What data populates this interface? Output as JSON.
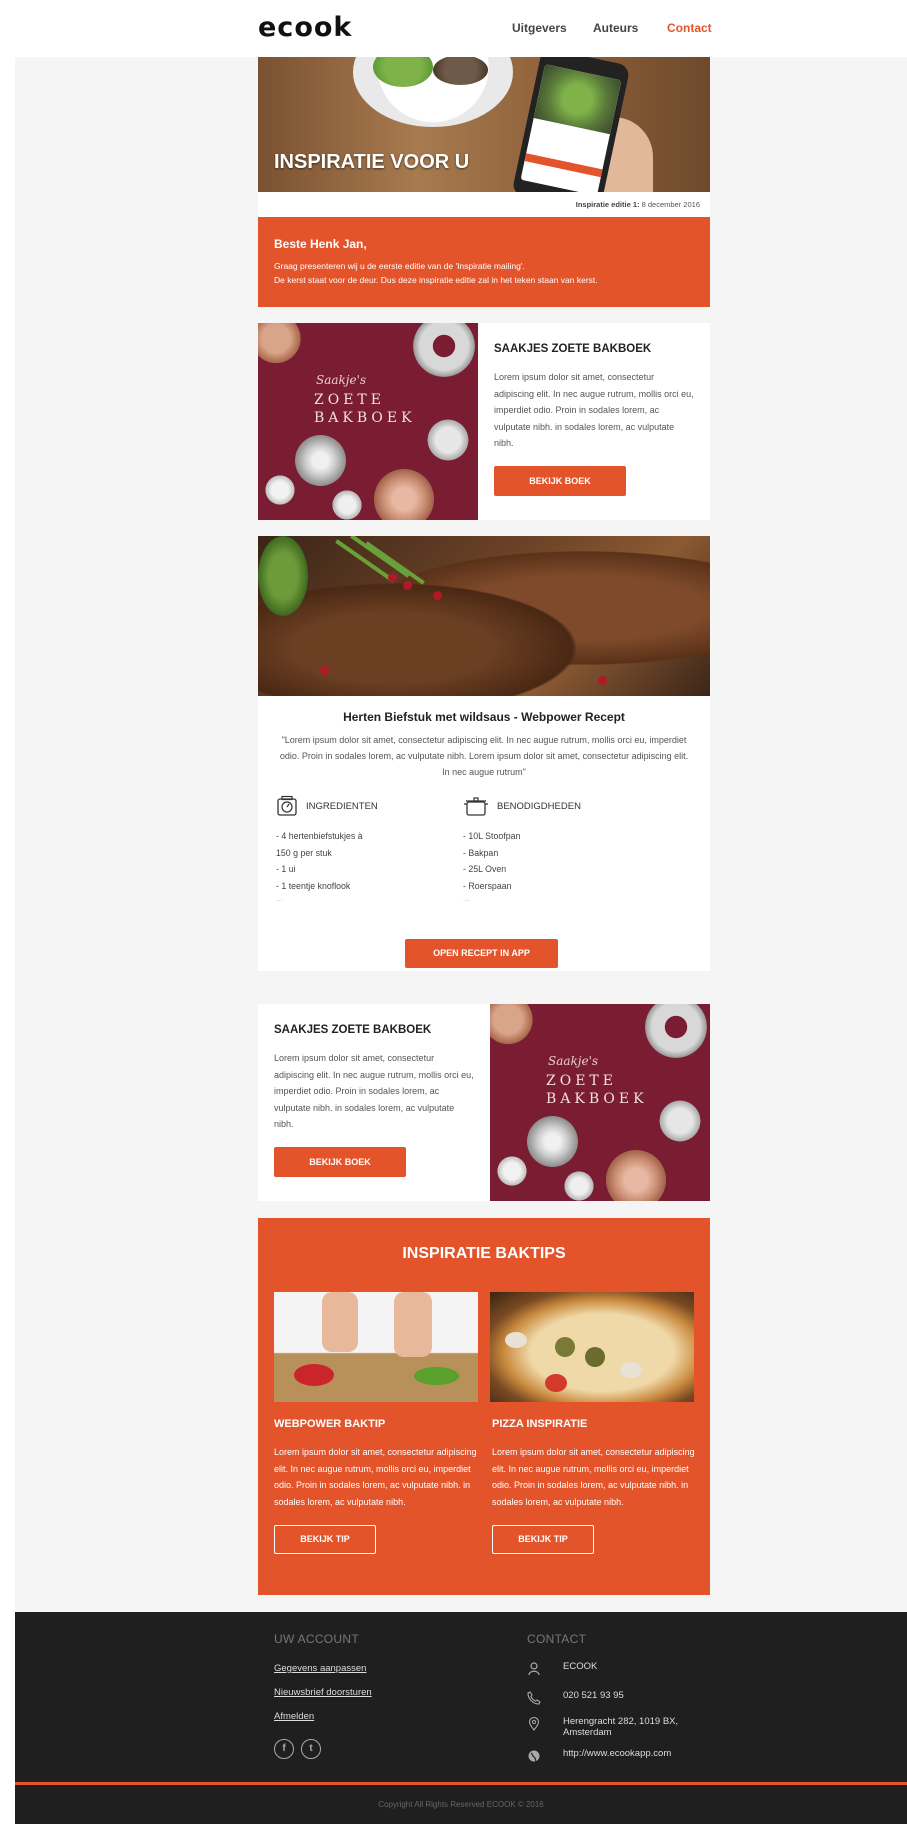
{
  "header": {
    "logo": "ecook",
    "nav": [
      "Uitgevers",
      "Auteurs",
      "Contact"
    ]
  },
  "hero": {
    "title": "INSPIRATIE VOOR U",
    "edition_label": "Inspiratie editie 1:",
    "edition_date": " 8 december 2016"
  },
  "greeting": {
    "title": "Beste Henk Jan,",
    "line1": "Graag presenteren wij u de eerste editie van de 'Inspiratie mailing'.",
    "line2": "De kerst staat voor de deur. Dus deze inspiratie editie zal in het teken staan van kerst."
  },
  "book1": {
    "title": "SAAKJES ZOETE BAKBOEK",
    "text": "Lorem ipsum dolor sit amet, consectetur adipiscing elit. In nec augue rutrum, mollis orci eu, imperdiet odio. Proin in sodales lorem, ac vulputate nibh. in sodales lorem, ac vulputate nibh.",
    "button": "BEKIJK BOEK",
    "cover_script": "Saakje's",
    "cover_title": "ZOETE BAKBOEK"
  },
  "recipe": {
    "title": "Herten Biefstuk met wildsaus  -  Webpower Recept",
    "quote": "\"Lorem ipsum dolor sit amet, consectetur adipiscing elit. In nec augue rutrum, mollis orci eu, imperdiet odio. Proin in sodales lorem, ac vulputate nibh. Lorem ipsum dolor sit amet, consectetur adipiscing elit. In nec augue rutrum\"",
    "ingredients_label": "INGREDIENTEN",
    "ingredients": [
      "- 4 hertenbiefstukjes à",
      "150 g per stuk",
      "- 1 ui",
      "- 1 teentje knoflook"
    ],
    "tools_label": "BENODIGDHEDEN",
    "tools": [
      "- 10L Stoofpan",
      "- Bakpan",
      "- 25L Oven",
      "- Roerspaan"
    ],
    "more": "...",
    "button": "OPEN RECEPT IN APP"
  },
  "book2": {
    "title": "SAAKJES ZOETE BAKBOEK",
    "text": "Lorem ipsum dolor sit amet, consectetur adipiscing elit. In nec augue rutrum, mollis orci eu, imperdiet odio. Proin in sodales lorem, ac vulputate nibh. in sodales lorem, ac vulputate nibh.",
    "button": "BEKIJK BOEK",
    "cover_script": "Saakje's",
    "cover_title": "ZOETE BAKBOEK"
  },
  "baktips": {
    "title": "INSPIRATIE BAKTIPS",
    "items": [
      {
        "title": "WEBPOWER BAKTIP",
        "text": "Lorem ipsum dolor sit amet, consectetur adipiscing elit. In nec augue rutrum, mollis orci eu, imperdiet odio. Proin in sodales lorem, ac vulputate nibh. in sodales lorem, ac vulputate nibh.",
        "button": "BEKIJK TIP"
      },
      {
        "title": "PIZZA INSPIRATIE",
        "text": "Lorem ipsum dolor sit amet, consectetur adipiscing elit. In nec augue rutrum, mollis orci eu, imperdiet odio. Proin in sodales lorem, ac vulputate nibh. in sodales lorem, ac vulputate nibh.",
        "button": "BEKIJK TIP"
      }
    ]
  },
  "footer": {
    "account_title": "UW ACCOUNT",
    "account_links": [
      "Gegevens aanpassen",
      "Nieuwsbrief doorsturen",
      "Afmelden"
    ],
    "contact_title": "CONTACT",
    "contact_items": [
      {
        "icon": "user-icon",
        "text": "ECOOK"
      },
      {
        "icon": "phone-icon",
        "text": "020 521 93 95"
      },
      {
        "icon": "location-icon",
        "text_line1": "Herengracht 282, 1019 BX,",
        "text_line2": "Amsterdam"
      },
      {
        "icon": "globe-icon",
        "text": "http://www.ecookapp.com"
      }
    ],
    "social": [
      "facebook-icon",
      "twitter-icon"
    ],
    "copyright": "Copyright All Rights Reserved ECOOK © 2016"
  },
  "colors": {
    "accent": "#e4542b",
    "footer": "#1f1f1f",
    "cover": "#7a1d32"
  }
}
